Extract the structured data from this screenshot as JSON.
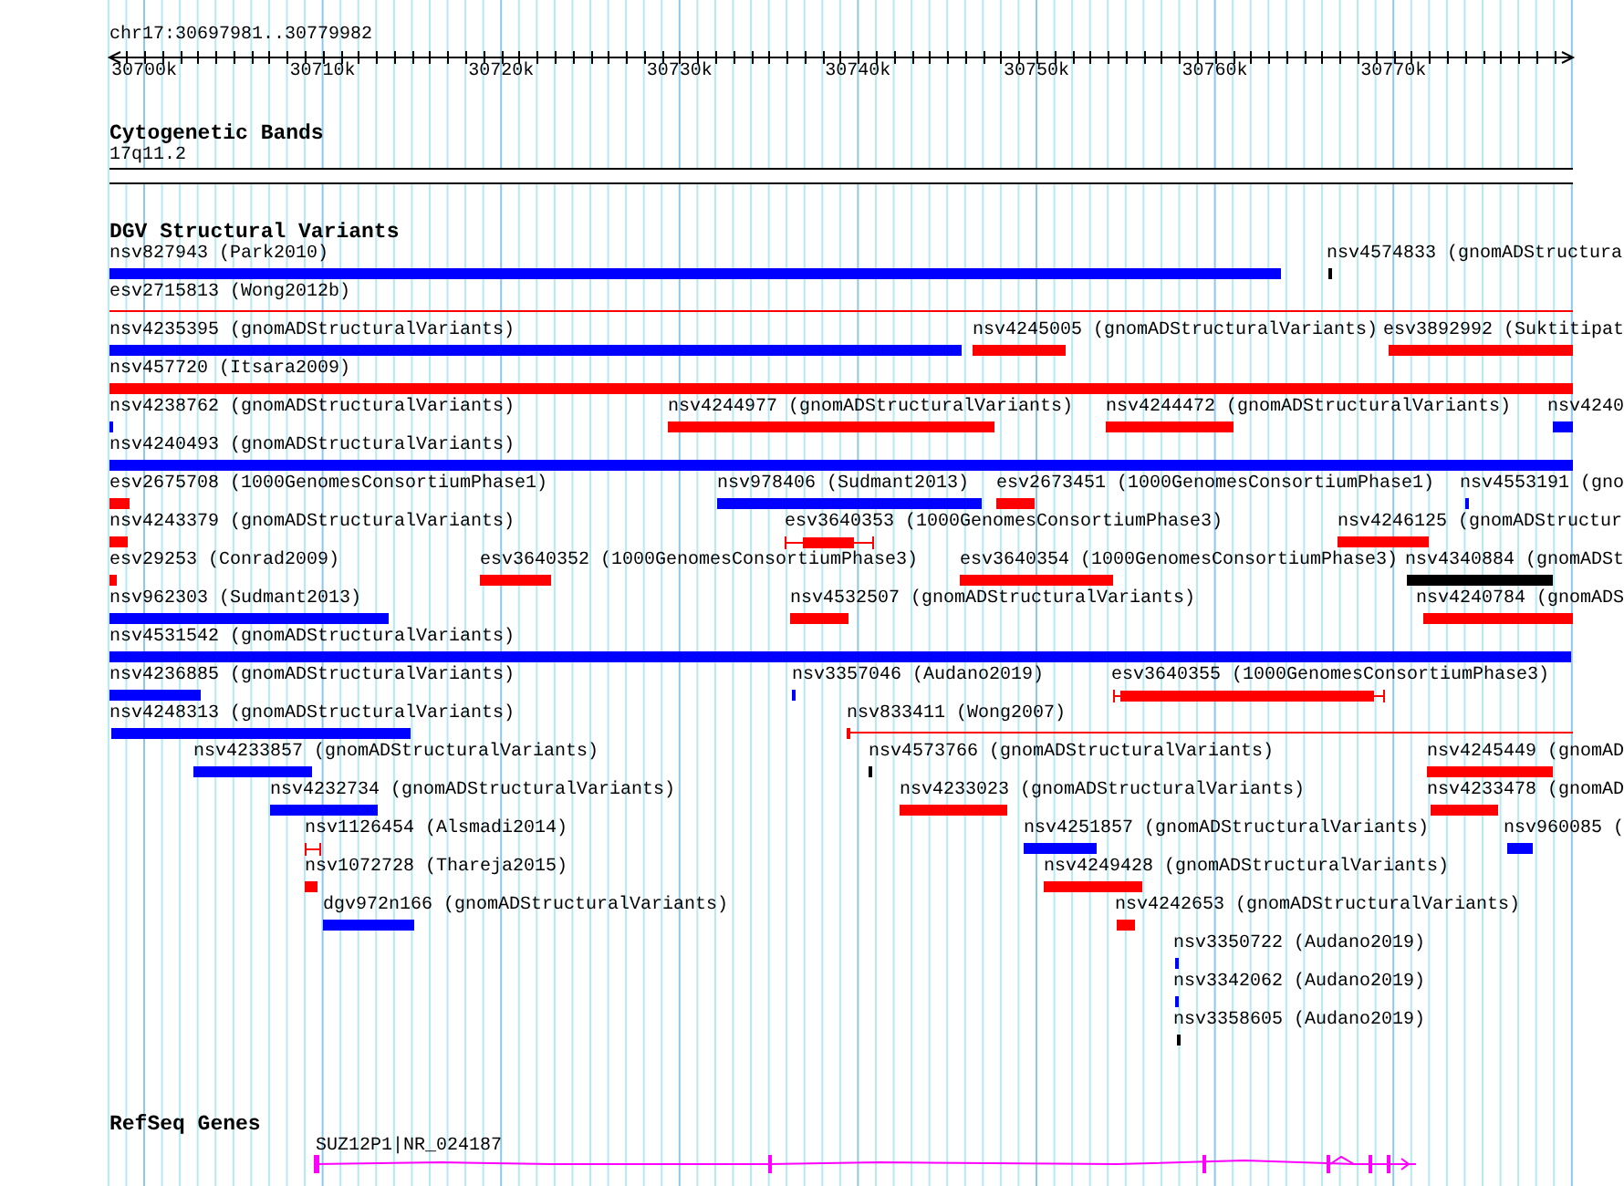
{
  "ruler": {
    "location": "chr17:30697981..30779982",
    "ticks": [
      "30700k",
      "30710k",
      "30720k",
      "30730k",
      "30740k",
      "30750k",
      "30760k",
      "30770k"
    ]
  },
  "tracks": [
    {
      "title": "Cytogenetic Bands",
      "kind": "cytoband",
      "band": "17q11.2"
    },
    {
      "title": "DGV Structural Variants",
      "kind": "variants",
      "rows": [
        [
          {
            "label": "nsv827943 (Park2010)",
            "color": "#0000ff",
            "kind": "bar"
          },
          {
            "label": "nsv4574833 (gnomADStructura",
            "color": "#000000",
            "kind": "bar"
          }
        ],
        [
          {
            "label": "esv2715813 (Wong2012b)",
            "color": "#ff0000",
            "kind": "line"
          }
        ],
        [
          {
            "label": "nsv4235395 (gnomADStructuralVariants)",
            "color": "#0000ff",
            "kind": "bar"
          },
          {
            "label": "nsv4245005 (gnomADStructuralVariants)",
            "color": "#ff0000",
            "kind": "bar"
          },
          {
            "label": "esv3892992 (Suktitipat",
            "color": "#ff0000",
            "kind": "bar"
          }
        ],
        [
          {
            "label": "nsv457720 (Itsara2009)",
            "color": "#ff0000",
            "kind": "bar"
          }
        ],
        [
          {
            "label": "nsv4238762 (gnomADStructuralVariants)",
            "color": "#0000ff",
            "kind": "bar"
          },
          {
            "label": "nsv4244977 (gnomADStructuralVariants)",
            "color": "#ff0000",
            "kind": "bar"
          },
          {
            "label": "nsv4244472 (gnomADStructuralVariants)",
            "color": "#ff0000",
            "kind": "bar"
          },
          {
            "label": "nsv4240",
            "color": "#0000ff",
            "kind": "bar"
          }
        ],
        [
          {
            "label": "nsv4240493 (gnomADStructuralVariants)",
            "color": "#0000ff",
            "kind": "bar"
          }
        ],
        [
          {
            "label": "esv2675708 (1000GenomesConsortiumPhase1)",
            "color": "#ff0000",
            "kind": "bar"
          },
          {
            "label": "nsv978406 (Sudmant2013)",
            "color": "#0000ff",
            "kind": "bar"
          },
          {
            "label": "esv2673451 (1000GenomesConsortiumPhase1)",
            "color": "#ff0000",
            "kind": "bar"
          },
          {
            "label": "nsv4553191 (gno",
            "color": "#0000ff",
            "kind": "bar"
          }
        ],
        [
          {
            "label": "nsv4243379 (gnomADStructuralVariants)",
            "color": "#ff0000",
            "kind": "bar"
          },
          {
            "label": "esv3640353 (1000GenomesConsortiumPhase3)",
            "color": "#ff0000",
            "kind": "range"
          },
          {
            "label": "nsv4246125 (gnomADStructur",
            "color": "#ff0000",
            "kind": "bar"
          }
        ],
        [
          {
            "label": "esv29253 (Conrad2009)",
            "color": "#ff0000",
            "kind": "bar"
          },
          {
            "label": "esv3640352 (1000GenomesConsortiumPhase3)",
            "color": "#ff0000",
            "kind": "bar"
          },
          {
            "label": "esv3640354 (1000GenomesConsortiumPhase3)",
            "color": "#ff0000",
            "kind": "bar"
          },
          {
            "label": "nsv4340884 (gnomADSt",
            "color": "#000000",
            "kind": "bar"
          }
        ],
        [
          {
            "label": "nsv962303 (Sudmant2013)",
            "color": "#0000ff",
            "kind": "bar"
          },
          {
            "label": "nsv4532507 (gnomADStructuralVariants)",
            "color": "#ff0000",
            "kind": "bar"
          },
          {
            "label": "nsv4240784 (gnomADS",
            "color": "#ff0000",
            "kind": "bar"
          }
        ],
        [
          {
            "label": "nsv4531542 (gnomADStructuralVariants)",
            "color": "#0000ff",
            "kind": "bar"
          }
        ],
        [
          {
            "label": "nsv4236885 (gnomADStructuralVariants)",
            "color": "#0000ff",
            "kind": "bar"
          },
          {
            "label": "nsv3357046 (Audano2019)",
            "color": "#0000ff",
            "kind": "bar"
          },
          {
            "label": "esv3640355 (1000GenomesConsortiumPhase3)",
            "color": "#ff0000",
            "kind": "range"
          }
        ],
        [
          {
            "label": "nsv4248313 (gnomADStructuralVariants)",
            "color": "#0000ff",
            "kind": "bar"
          },
          {
            "label": "nsv833411 (Wong2007)",
            "color": "#ff0000",
            "kind": "line"
          }
        ],
        [
          {
            "label": "nsv4233857 (gnomADStructuralVariants)",
            "color": "#0000ff",
            "kind": "bar"
          },
          {
            "label": "nsv4573766 (gnomADStructuralVariants)",
            "color": "#000000",
            "kind": "bar"
          },
          {
            "label": "nsv4245449 (gnomAD",
            "color": "#ff0000",
            "kind": "bar"
          }
        ],
        [
          {
            "label": "nsv4232734 (gnomADStructuralVariants)",
            "color": "#0000ff",
            "kind": "bar"
          },
          {
            "label": "nsv4233023 (gnomADStructuralVariants)",
            "color": "#ff0000",
            "kind": "bar"
          },
          {
            "label": "nsv4233478 (gnomAD",
            "color": "#ff0000",
            "kind": "bar"
          }
        ],
        [
          {
            "label": "nsv1126454 (Alsmadi2014)",
            "color": "#ff0000",
            "kind": "range"
          },
          {
            "label": "nsv4251857 (gnomADStructuralVariants)",
            "color": "#0000ff",
            "kind": "bar"
          },
          {
            "label": "nsv960085 (",
            "color": "#0000ff",
            "kind": "bar"
          }
        ],
        [
          {
            "label": "nsv1072728 (Thareja2015)",
            "color": "#ff0000",
            "kind": "bar"
          },
          {
            "label": "nsv4249428 (gnomADStructuralVariants)",
            "color": "#ff0000",
            "kind": "bar"
          }
        ],
        [
          {
            "label": "dgv972n166 (gnomADStructuralVariants)",
            "color": "#0000ff",
            "kind": "bar"
          },
          {
            "label": "nsv4242653 (gnomADStructuralVariants)",
            "color": "#ff0000",
            "kind": "bar"
          }
        ],
        [
          {
            "label": "nsv3350722 (Audano2019)",
            "color": "#0000ff",
            "kind": "bar"
          }
        ],
        [
          {
            "label": "nsv3342062 (Audano2019)",
            "color": "#0000ff",
            "kind": "bar"
          }
        ],
        [
          {
            "label": "nsv3358605 (Audano2019)",
            "color": "#000000",
            "kind": "bar"
          }
        ]
      ]
    },
    {
      "title": "RefSeq Genes",
      "kind": "genes",
      "genes": [
        {
          "label": "SUZ12P1|NR_024187",
          "color": "#ff00ff"
        }
      ]
    }
  ]
}
